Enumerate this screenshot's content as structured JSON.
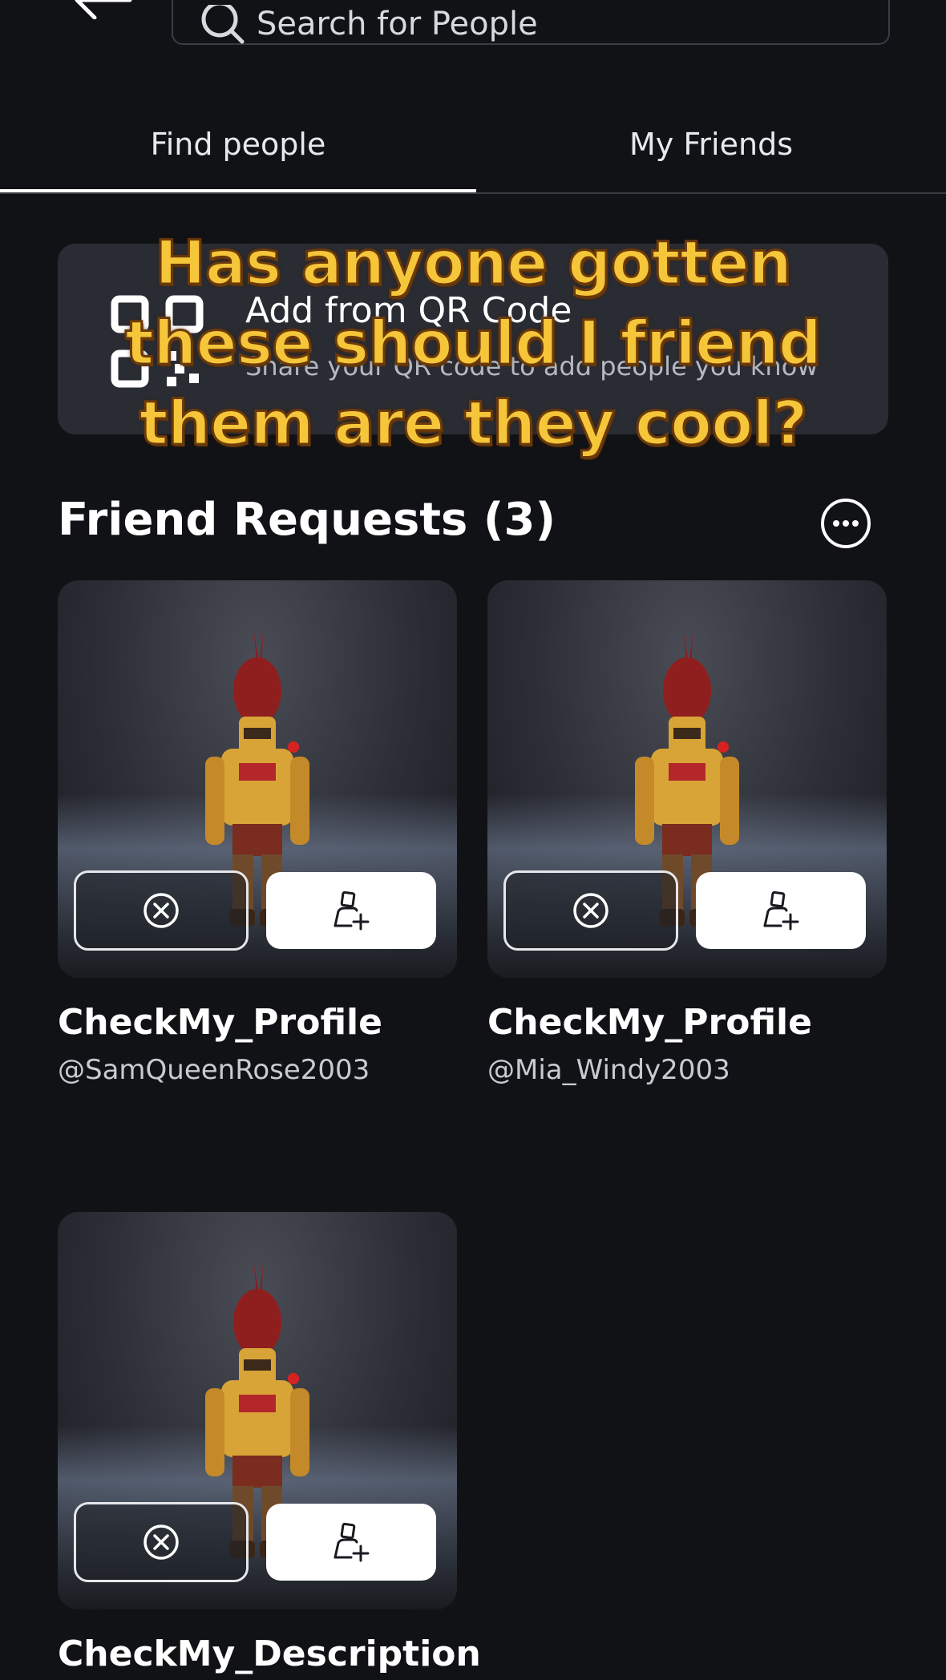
{
  "search": {
    "placeholder": "Search for People"
  },
  "tabs": [
    {
      "label": "Find people",
      "active": true
    },
    {
      "label": "My Friends",
      "active": false
    }
  ],
  "qr_card": {
    "title": "Add from QR Code",
    "subtitle": "Share your QR code to add people you know"
  },
  "caption": {
    "text": "Has anyone gotten these should I friend them are they cool?"
  },
  "friend_requests": {
    "title": "Friend Requests (3)",
    "items": [
      {
        "name": "CheckMy_Profile",
        "handle": "@SamQueenRose2003"
      },
      {
        "name": "CheckMy_Profile",
        "handle": "@Mia_Windy2003"
      },
      {
        "name": "CheckMy_Description",
        "handle": ""
      }
    ]
  },
  "colors": {
    "background": "#111216",
    "card": "#2a2c33",
    "caption_fill": "#f5c63a",
    "caption_outline": "#6b3a0a",
    "accept_button": "#ffffff"
  },
  "icons": {
    "back": "arrow-left-icon",
    "search": "search-icon",
    "qr": "qr-code-icon",
    "more": "more-horizontal-icon",
    "decline": "close-circle-icon",
    "accept": "add-friend-icon"
  }
}
